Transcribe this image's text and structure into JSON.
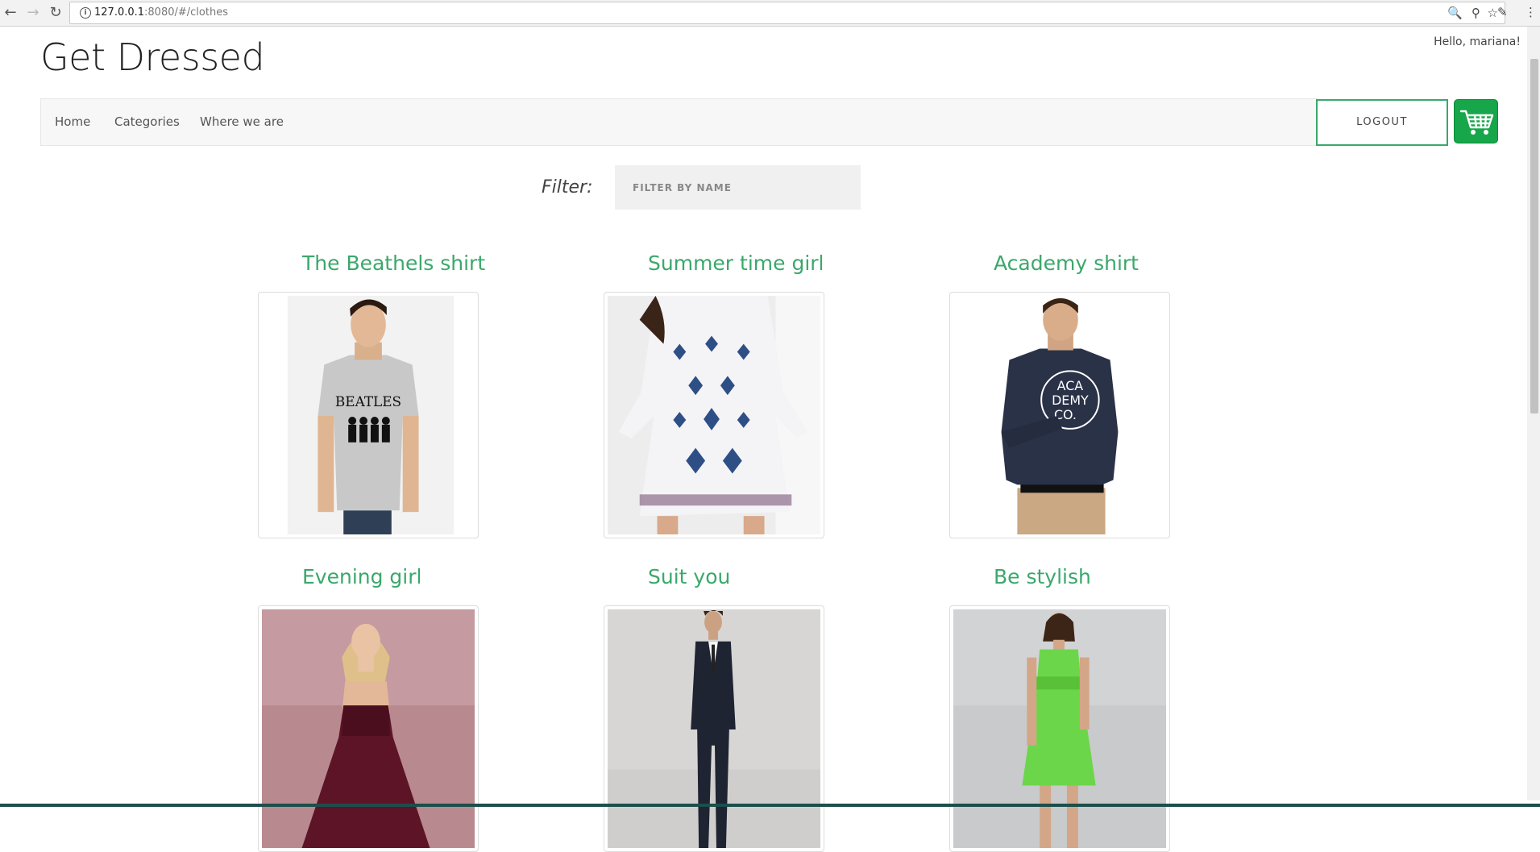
{
  "browser": {
    "url_host": "127.0.0.1",
    "url_path": ":8080/#/clothes",
    "back_icon": "arrow-left-icon",
    "forward_icon": "arrow-right-icon",
    "reload_icon": "reload-icon"
  },
  "header": {
    "site_title": "Get Dressed",
    "greeting": "Hello, mariana!"
  },
  "nav": {
    "items": [
      {
        "label": "Home"
      },
      {
        "label": "Categories"
      },
      {
        "label": "Where we are"
      }
    ],
    "logout_label": "LOGOUT",
    "cart_icon": "shopping-cart-icon"
  },
  "filter": {
    "label": "Filter:",
    "placeholder": "FILTER BY NAME",
    "value": ""
  },
  "products": [
    {
      "name": "The Beathels shirt"
    },
    {
      "name": "Summer time girl"
    },
    {
      "name": "Academy shirt"
    },
    {
      "name": "Evening girl"
    },
    {
      "name": "Suit you"
    },
    {
      "name": "Be stylish"
    }
  ],
  "colors": {
    "accent": "#3aa86b",
    "cart": "#17a64a"
  }
}
